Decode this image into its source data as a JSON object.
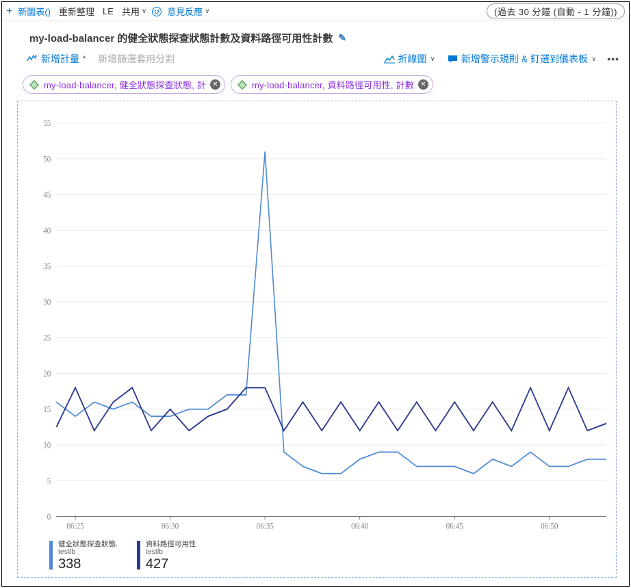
{
  "topbar": {
    "new_chart": "新圖表()",
    "refresh": "重新整理",
    "le": "LE",
    "share": "共用",
    "feedback": "意見反應",
    "time_range": "(過去 30 分鐘 (自動 -  1 分鐘))"
  },
  "title": "my-load-balancer 的健全狀態探查狀態計數及資料路徑可用性計數",
  "actions": {
    "add_metric": "新增計量",
    "filter_placeholder": "新增篩選套用分割",
    "chart_type": "折線圖",
    "alert_pin": "新增警示規則 & 釘選到儀表板"
  },
  "pills": [
    {
      "text": "my-load-balancer, 健全狀態探查狀態, 計"
    },
    {
      "text": "my-load-balancer, 資料路徑可用性, 計數"
    }
  ],
  "legend": {
    "s1": {
      "name": "健全狀態探查狀態.",
      "resource": "testlb",
      "value": "338"
    },
    "s2": {
      "name": "資料路徑可用性",
      "resource": "testlb",
      "value": "427"
    }
  },
  "chart_data": {
    "type": "line",
    "xlabel": "",
    "ylabel": "",
    "ylim": [
      0,
      56
    ],
    "y_ticks": [
      0,
      5,
      10,
      15,
      20,
      25,
      30,
      35,
      40,
      45,
      50,
      55
    ],
    "x_tick_labels": [
      "06:25",
      "06:30",
      "06:35",
      "06:40",
      "06:45",
      "06:50"
    ],
    "x": [
      0,
      1,
      2,
      3,
      4,
      5,
      6,
      7,
      8,
      9,
      10,
      11,
      12,
      13,
      14,
      15,
      16,
      17,
      18,
      19,
      20,
      21,
      22,
      23,
      24,
      25,
      26,
      27,
      28,
      29
    ],
    "series": [
      {
        "name": "健全狀態探查狀態 (testlb)",
        "color": "#4f8ad6",
        "values": [
          16,
          14,
          16,
          15,
          16,
          14,
          14,
          15,
          15,
          17,
          17,
          51,
          9,
          7,
          6,
          6,
          8,
          9,
          9,
          7,
          7,
          7,
          6,
          8,
          7,
          9,
          7,
          7,
          8,
          8
        ]
      },
      {
        "name": "資料路徑可用性 (testlb)",
        "color": "#2d3a8c",
        "values": [
          12.5,
          18,
          12,
          16,
          18,
          12,
          15,
          12,
          14,
          15,
          18,
          18,
          12,
          16,
          12,
          16,
          12,
          16,
          12,
          16,
          12,
          16,
          12,
          16,
          12,
          18,
          12,
          18,
          12,
          13
        ]
      }
    ]
  }
}
